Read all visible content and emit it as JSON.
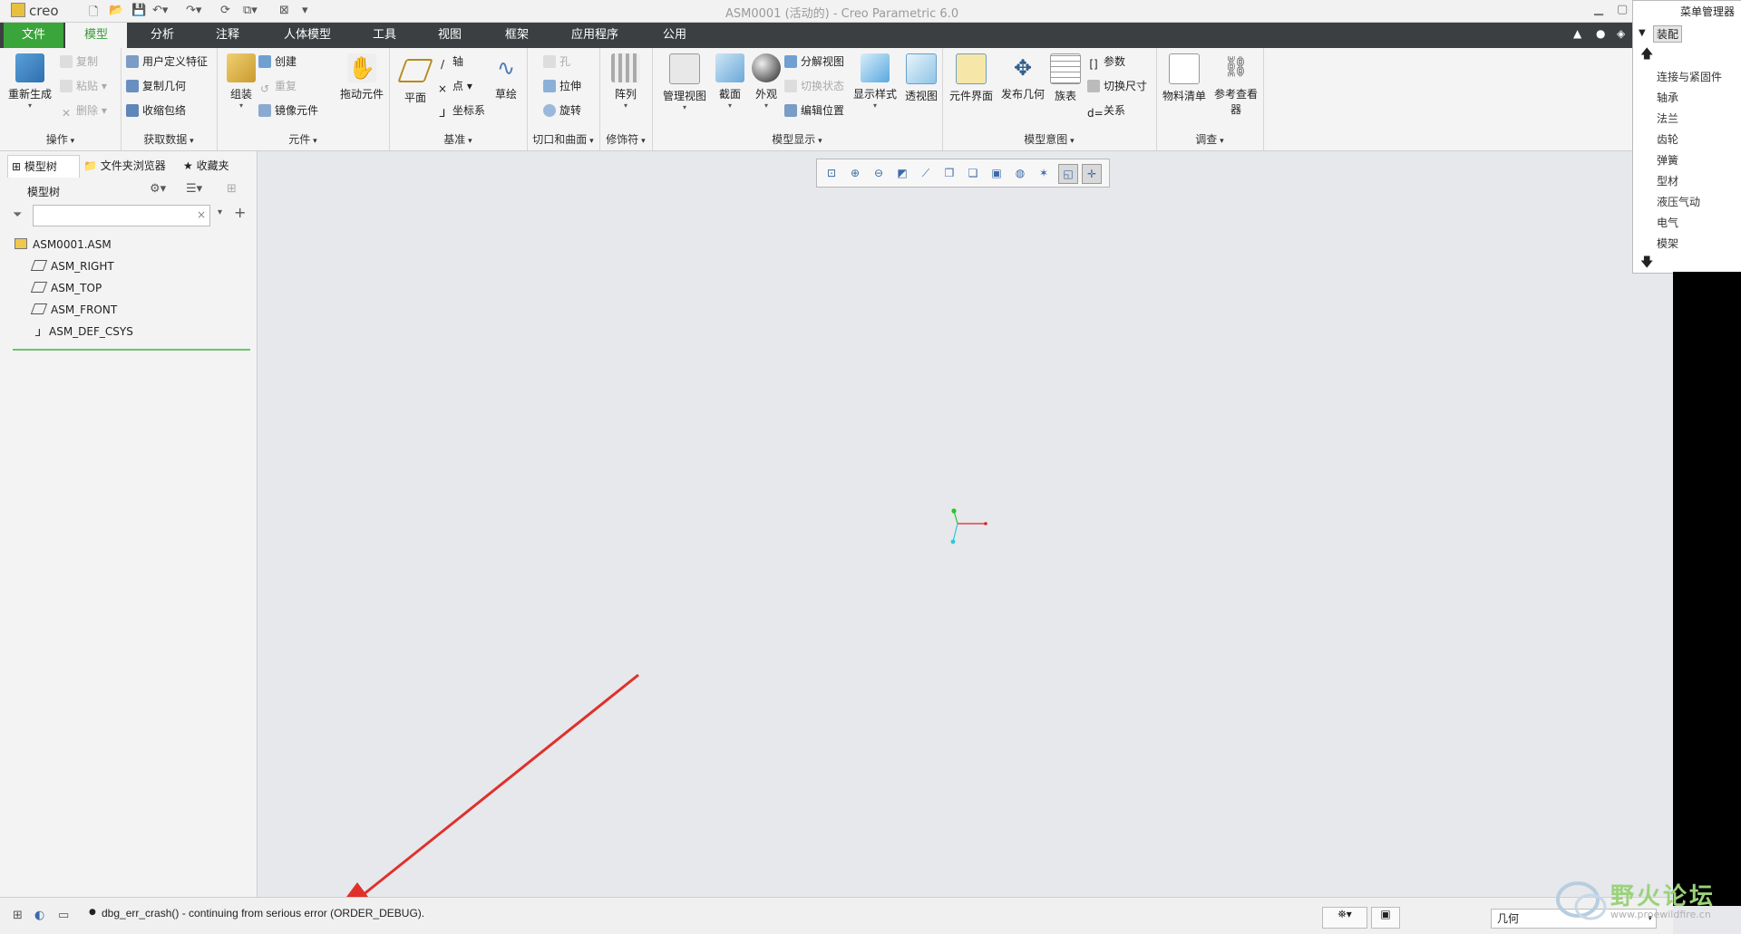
{
  "titlebar": {
    "logo": "creo",
    "window_title": "ASM0001 (活动的) - Creo Parametric 6.0"
  },
  "tabs": [
    {
      "label": "文件"
    },
    {
      "label": "模型"
    },
    {
      "label": "分析"
    },
    {
      "label": "注释"
    },
    {
      "label": "人体模型"
    },
    {
      "label": "工具"
    },
    {
      "label": "视图"
    },
    {
      "label": "框架"
    },
    {
      "label": "应用程序"
    },
    {
      "label": "公用"
    }
  ],
  "ribbon": {
    "groups": {
      "ops": "操作",
      "getdata": "获取数据",
      "component": "元件",
      "datum": "基准",
      "cutsurf": "切口和曲面",
      "modifier": "修饰符",
      "modeldisplay": "模型显示",
      "modelintent": "模型意图",
      "investigate": "调查"
    },
    "buttons": {
      "regen": "重新生成",
      "copy": "复制",
      "paste": "粘贴",
      "delete": "删除",
      "udf": "用户定义特征",
      "copygeom": "复制几何",
      "shrinkwrap": "收缩包络",
      "assemble": "组装",
      "create": "创建",
      "repeat": "重复",
      "mirror": "镜像元件",
      "drag": "拖动元件",
      "plane": "平面",
      "axis": "轴",
      "point": "点",
      "csys": "坐标系",
      "sketch": "草绘",
      "hole": "孔",
      "extrude": "拉伸",
      "revolve": "旋转",
      "pattern": "阵列",
      "manageviews": "管理视图",
      "section": "截面",
      "appearance": "外观",
      "explode": "分解视图",
      "togglestate": "切换状态",
      "editpos": "编辑位置",
      "displaystyle": "显示样式",
      "perspective": "透视图",
      "compinterface": "元件界面",
      "publishgeom": "发布几何",
      "familytable": "族表",
      "params": "参数",
      "toggledims": "切换尺寸",
      "relations": "关系",
      "bom": "物料清单",
      "refviewer": "参考查看器"
    }
  },
  "leftpanel": {
    "tabs": [
      "模型树",
      "文件夹浏览器",
      "收藏夹"
    ],
    "header": "模型树",
    "tree": [
      "ASM0001.ASM",
      "ASM_RIGHT",
      "ASM_TOP",
      "ASM_FRONT",
      "ASM_DEF_CSYS"
    ]
  },
  "menumanager": {
    "title": "菜单管理器",
    "selected": "装配",
    "items": [
      "连接与紧固件",
      "轴承",
      "法兰",
      "齿轮",
      "弹簧",
      "型材",
      "液压气动",
      "电气",
      "模架"
    ]
  },
  "statusbar": {
    "message": "dbg_err_crash() - continuing from serious error (ORDER_DEBUG).",
    "filter": "几何"
  },
  "watermark": {
    "text": "野火论坛",
    "url": "www.proewildfire.cn"
  },
  "colors": {
    "accent_green": "#3aa53a",
    "tabbar_bg": "#3c3f41",
    "graphics_bg": "#e6e8ec",
    "arrow_red": "#e0302a"
  }
}
